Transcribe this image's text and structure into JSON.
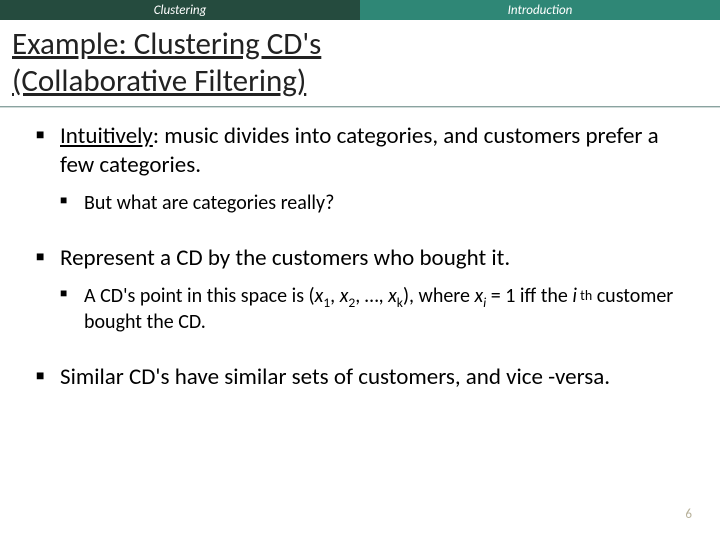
{
  "topbar": {
    "left": "Clustering",
    "right": "Introduction"
  },
  "title": {
    "line1": "Example: Clustering CD's",
    "line2": " (Collaborative Filtering)"
  },
  "bullets": {
    "b1_lead": "Intuitively",
    "b1_rest": ": music divides into categories, and customers prefer a few categories.",
    "b1_sub": "But what are categories really?",
    "b2": "Represent a CD by the customers who bought it.",
    "b2_sub_prefix": "A CD's point in this space is   (",
    "b2_sub_x": "x",
    "b2_sub_sep": ", ",
    "b2_sub_ell": ", …, ",
    "b2_sub_where": "), where ",
    "b2_sub_eq": " = 1 iff the ",
    "b2_sub_i": "i",
    "b2_sub_th": " th",
    "b2_sub_end": " customer bought the CD.",
    "idx1": "1",
    "idx2": "2",
    "idxk": "k",
    "idxi": "i",
    "b3": "Similar CD's have similar sets of customers, and vice -versa."
  },
  "page": "6"
}
